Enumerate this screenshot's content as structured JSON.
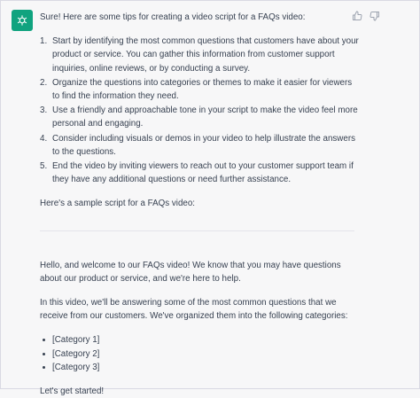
{
  "message": {
    "intro": "Sure! Here are some tips for creating a video script for a FAQs video:",
    "tips": [
      {
        "num": "1.",
        "text": "Start by identifying the most common questions that customers have about your product or service. You can gather this information from customer support inquiries, online reviews, or by conducting a survey."
      },
      {
        "num": "2.",
        "text": "Organize the questions into categories or themes to make it easier for viewers to find the information they need."
      },
      {
        "num": "3.",
        "text": "Use a friendly and approachable tone in your script to make the video feel more personal and engaging."
      },
      {
        "num": "4.",
        "text": "Consider including visuals or demos in your video to help illustrate the answers to the questions."
      },
      {
        "num": "5.",
        "text": "End the video by inviting viewers to reach out to your customer support team if they have any additional questions or need further assistance."
      }
    ],
    "sample_intro": "Here's a sample script for a FAQs video:",
    "script": {
      "hello": "Hello, and welcome to our FAQs video! We know that you may have questions about our product or service, and we're here to help.",
      "para2": "In this video, we'll be answering some of the most common questions that we receive from our customers. We've organized them into the following categories:",
      "categories": [
        "[Category 1]",
        "[Category 2]",
        "[Category 3]"
      ],
      "closing": "Let's get started!"
    }
  },
  "icons": {
    "avatar": "openai-logo-icon",
    "thumbs_up": "thumbs-up-icon",
    "thumbs_down": "thumbs-down-icon"
  },
  "colors": {
    "avatar_bg": "#10a37f",
    "text": "#374151",
    "background": "#f7f7f8"
  }
}
